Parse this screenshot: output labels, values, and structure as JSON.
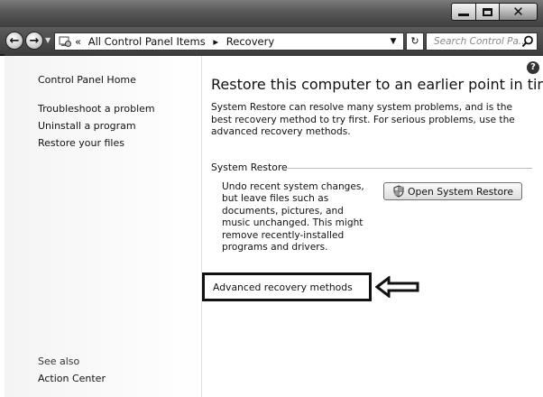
{
  "window": {
    "caption_buttons": {
      "minimize_icon": "minimize-icon",
      "maximize_icon": "maximize-icon",
      "close_icon": "close-icon"
    }
  },
  "navbar": {
    "breadcrumb": {
      "prefix": "«",
      "items": [
        "All Control Panel Items",
        "Recovery"
      ],
      "separator": "▸"
    },
    "search": {
      "placeholder": "Search Control Pa..."
    }
  },
  "left_pane": {
    "home": "Control Panel Home",
    "links": [
      "Troubleshoot a problem",
      "Uninstall a program",
      "Restore your files"
    ],
    "see_also": {
      "heading": "See also",
      "items": [
        "Action Center"
      ]
    }
  },
  "main": {
    "title": "Restore this computer to an earlier point in time",
    "description": "System Restore can resolve many system problems, and is the best recovery method to try first. For serious problems, use the advanced recovery methods.",
    "system_restore": {
      "title": "System Restore",
      "description": "Undo recent system changes, but leave files such as documents, pictures, and music unchanged. This might remove recently-installed programs and drivers.",
      "button_label": "Open System Restore"
    },
    "advanced_link": "Advanced recovery methods"
  },
  "colors": {
    "titlebar": "#4a4a4a",
    "content_bg": "#ffffff",
    "highlight_border": "#111111"
  }
}
